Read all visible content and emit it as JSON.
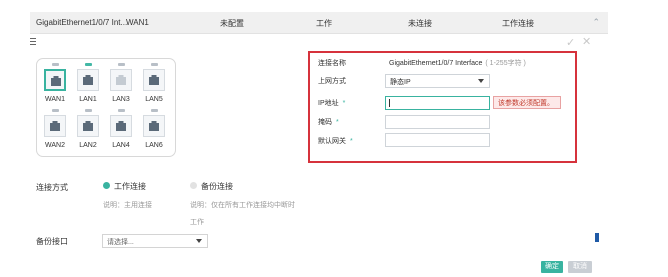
{
  "header": {
    "interface": "GigabitEthernet1/0/7 Int...",
    "alias": "WAN1",
    "config_status": "未配置",
    "work_state": "工作",
    "link_status": "未连接",
    "work_mode": "工作连接"
  },
  "ports": {
    "top": [
      {
        "label": "WAN1",
        "selected": true,
        "led_on": false,
        "light": false
      },
      {
        "label": "LAN1",
        "selected": false,
        "led_on": true,
        "light": false
      },
      {
        "label": "LAN3",
        "selected": false,
        "led_on": false,
        "light": true
      },
      {
        "label": "LAN5",
        "selected": false,
        "led_on": false,
        "light": false
      }
    ],
    "bottom": [
      {
        "label": "WAN2",
        "selected": false,
        "led_on": false,
        "light": false
      },
      {
        "label": "LAN2",
        "selected": false,
        "led_on": false,
        "light": false
      },
      {
        "label": "LAN4",
        "selected": false,
        "led_on": false,
        "light": false
      },
      {
        "label": "LAN6",
        "selected": false,
        "led_on": false,
        "light": false
      }
    ]
  },
  "form": {
    "conn_name_label": "连接名称",
    "conn_name_value": "GigabitEthernet1/0/7 Interface",
    "conn_name_hint": "( 1-255字符 )",
    "access_mode_label": "上网方式",
    "access_mode_value": "静态IP",
    "ip_label": "IP地址",
    "ip_value": "",
    "ip_error": "该参数必须配置。",
    "mask_label": "掩码",
    "mask_value": "",
    "gateway_label": "默认网关",
    "gateway_value": "",
    "required_mark": "*"
  },
  "connection": {
    "label": "连接方式",
    "primary_label": "工作连接",
    "primary_note": "说明：主用连接",
    "backup_label": "备份连接",
    "backup_note_line1": "说明：仅在所有工作连接均中断时",
    "backup_note_line2": "工作",
    "selected": "primary"
  },
  "backup_interface": {
    "label": "备份接口",
    "placeholder": "请选择..."
  },
  "buttons": {
    "confirm": "确定",
    "cancel": "取消"
  },
  "colors": {
    "accent": "#39b3a0",
    "error_border": "#d6323c",
    "brand_blue": "#1f5aa6"
  }
}
